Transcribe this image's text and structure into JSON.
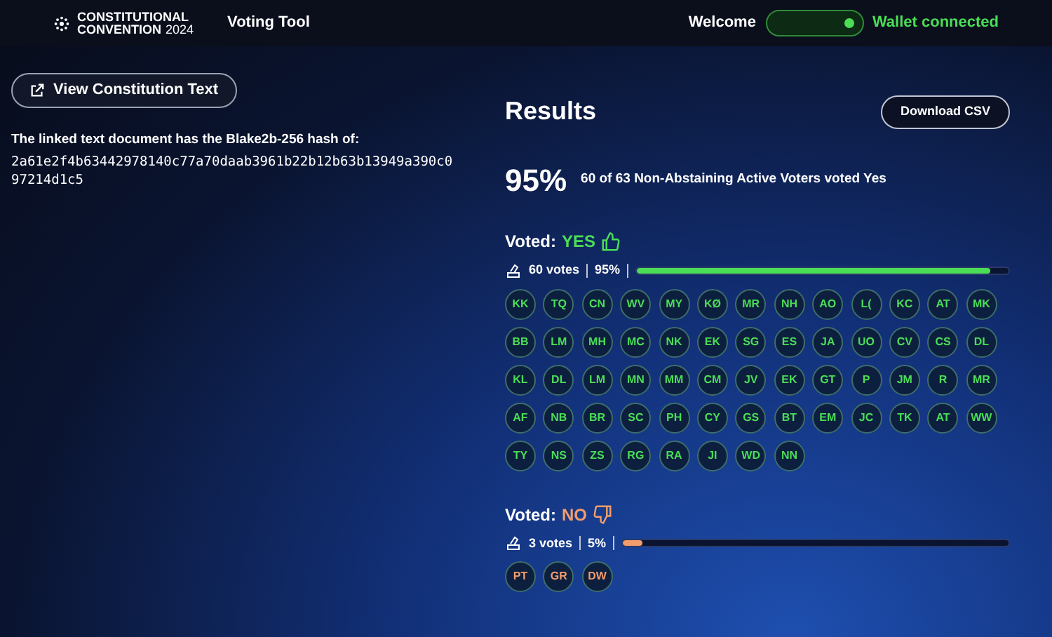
{
  "header": {
    "logo_line_1": "CONSTITUTIONAL",
    "logo_line_2": "CONVENTION",
    "logo_year": "2024",
    "app_name": "Voting Tool",
    "welcome": "Welcome",
    "wallet_status": "Wallet connected",
    "wallet_connected": true
  },
  "left": {
    "view_button": "View Constitution Text",
    "hash_intro": "The linked text document has the Blake2b-256 hash of:",
    "hash": "2a61e2f4b63442978140c77a70daab3961b22b12b63b13949a390c097214d1c5"
  },
  "results": {
    "title": "Results",
    "download_button": "Download CSV",
    "percent": "95%",
    "summary": "60 of 63 Non-Abstaining Active Voters voted Yes",
    "groups": [
      {
        "kind": "yes",
        "label": "Voted:",
        "choice": "YES",
        "votes": "60 votes",
        "share": "95%",
        "level": 0.95,
        "voters": [
          "KK",
          "TQ",
          "CN",
          "WV",
          "MY",
          "KØ",
          "MR",
          "NH",
          "AO",
          "L(",
          "KC",
          "AT",
          "MK",
          "BB",
          "LM",
          "MH",
          "MC",
          "NK",
          "EK",
          "SG",
          "ES",
          "JA",
          "UO",
          "CV",
          "CS",
          "DL",
          "KL",
          "DL",
          "LM",
          "MN",
          "MM",
          "CM",
          "JV",
          "EK",
          "GT",
          "P",
          "JM",
          "R",
          "MR",
          "AF",
          "NB",
          "BR",
          "SC",
          "PH",
          "CY",
          "GS",
          "BT",
          "EM",
          "JC",
          "TK",
          "AT",
          "WW",
          "TY",
          "NS",
          "ZS",
          "RG",
          "RA",
          "JI",
          "WD",
          "NN"
        ]
      },
      {
        "kind": "no",
        "label": "Voted:",
        "choice": "NO",
        "votes": "3 votes",
        "share": "5%",
        "level": 0.05,
        "voters": [
          "PT",
          "GR",
          "DW"
        ]
      }
    ]
  }
}
